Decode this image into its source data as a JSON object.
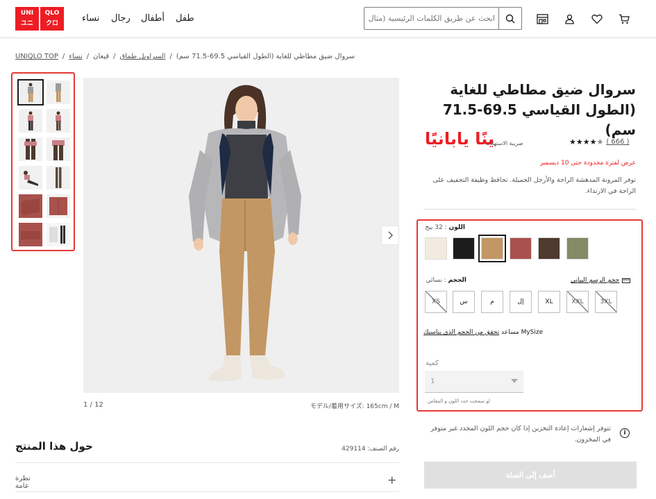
{
  "header": {
    "logo_top": "UNI",
    "logo_bottom": "QLO",
    "nav": [
      "طفل",
      "أطفال",
      "رجال",
      "نساء"
    ],
    "search_placeholder": "ابحث عن طريق الكلمات الرئيسية (مثال"
  },
  "breadcrumb": [
    "UNIQLO TOP",
    "نساء",
    "قيعان",
    "السراويل طماق",
    "سروال ضيق مطاطي للغاية (الطول القياسي 69.5-71.5 سم)"
  ],
  "gallery": {
    "counter": "1 / 12",
    "model_info": "モデル/着用サイズ: 165cm / M"
  },
  "about": {
    "title": "حول هذا المنتج",
    "sku": "رقم الصنف: 429114",
    "overview_label": "نظرة عامة"
  },
  "product": {
    "title": "سروال ضيق مطاطي للغاية (الطول القياسي 69.5-71.5 سم)",
    "price": "ينًا يابانيًا",
    "tax_note": "ضريبة الاستهلاك",
    "rating_count": "( 666 )",
    "rating_value": 4.5,
    "promo": "عرض لفترة محدودة حتى 10 ديسمبر",
    "description": "توفر المرونة المدهشة الراحة والأرجل الجميلة. تحافظ وظيفة التجفيف على الراحة في الارتداء."
  },
  "color": {
    "label": "اللون",
    "value": ": 32 بيج",
    "swatches": [
      "#f2ebdf",
      "#1c1c1c",
      "#c29763",
      "#a9514c",
      "#4e3a2e",
      "#838a64"
    ],
    "selected_index": 2
  },
  "size": {
    "label": "الحجم",
    "value": ": نسائي",
    "chart_link": "حجم الرسم البياني",
    "options": [
      "XS",
      "س",
      "م",
      "إل",
      "XL",
      "XXL",
      "3XL"
    ],
    "unavailable": [
      0,
      5,
      6
    ],
    "mysize_prefix": "MySize مساعد",
    "mysize_link": "تحقق من الحجم الذي يناسبك"
  },
  "quantity": {
    "label": "كمية",
    "value": "1",
    "note": "لو سمحت حدد اللون و المقاس"
  },
  "restock": "تتوفر إشعارات إعادة التخزين إذا كان حجم اللون المحدد غير متوفر في المخزون.",
  "add_to_cart": "أضف إلى السلة"
}
